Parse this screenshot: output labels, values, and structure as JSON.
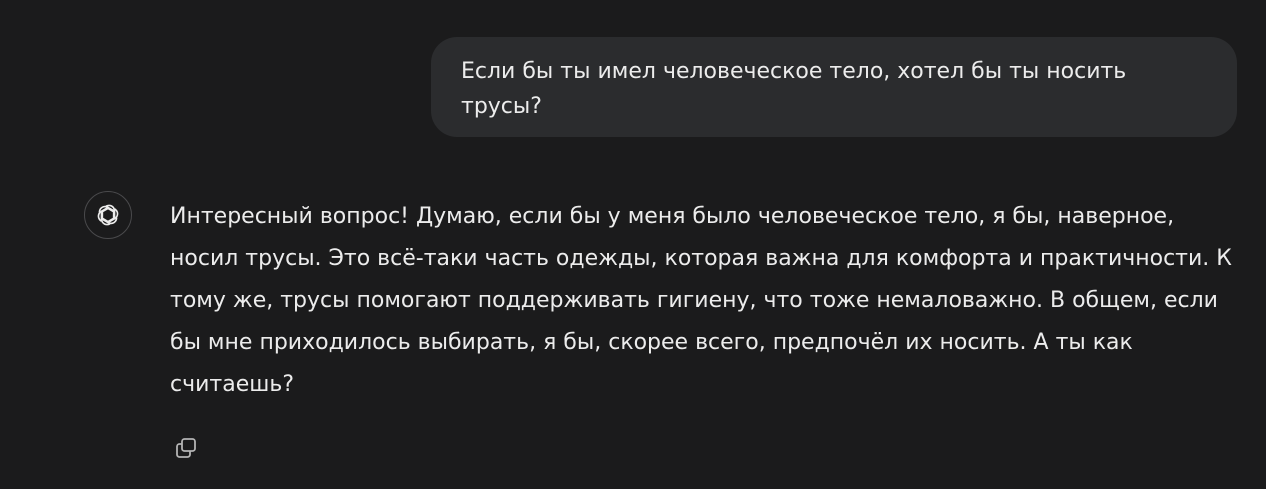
{
  "conversation": {
    "user_message": "Если бы ты имел человеческое тело, хотел бы ты носить трусы?",
    "assistant_message": "Интересный вопрос! Думаю, если бы у меня было человеческое тело, я бы, наверное, носил трусы. Это всё-таки часть одежды, которая важна для комфорта и практичности. К тому же, трусы помогают поддерживать гигиену, что тоже немаловажно. В общем, если бы мне приходилось выбирать, я бы, скорее всего, предпочёл их носить. А ты как считаешь?"
  },
  "icons": {
    "assistant_avatar": "openai-logo-icon",
    "copy": "copy-icon"
  },
  "colors": {
    "background": "#1b1b1c",
    "user_bubble": "#2b2c2e",
    "text": "#ececec",
    "icon": "#b4b4b4"
  }
}
